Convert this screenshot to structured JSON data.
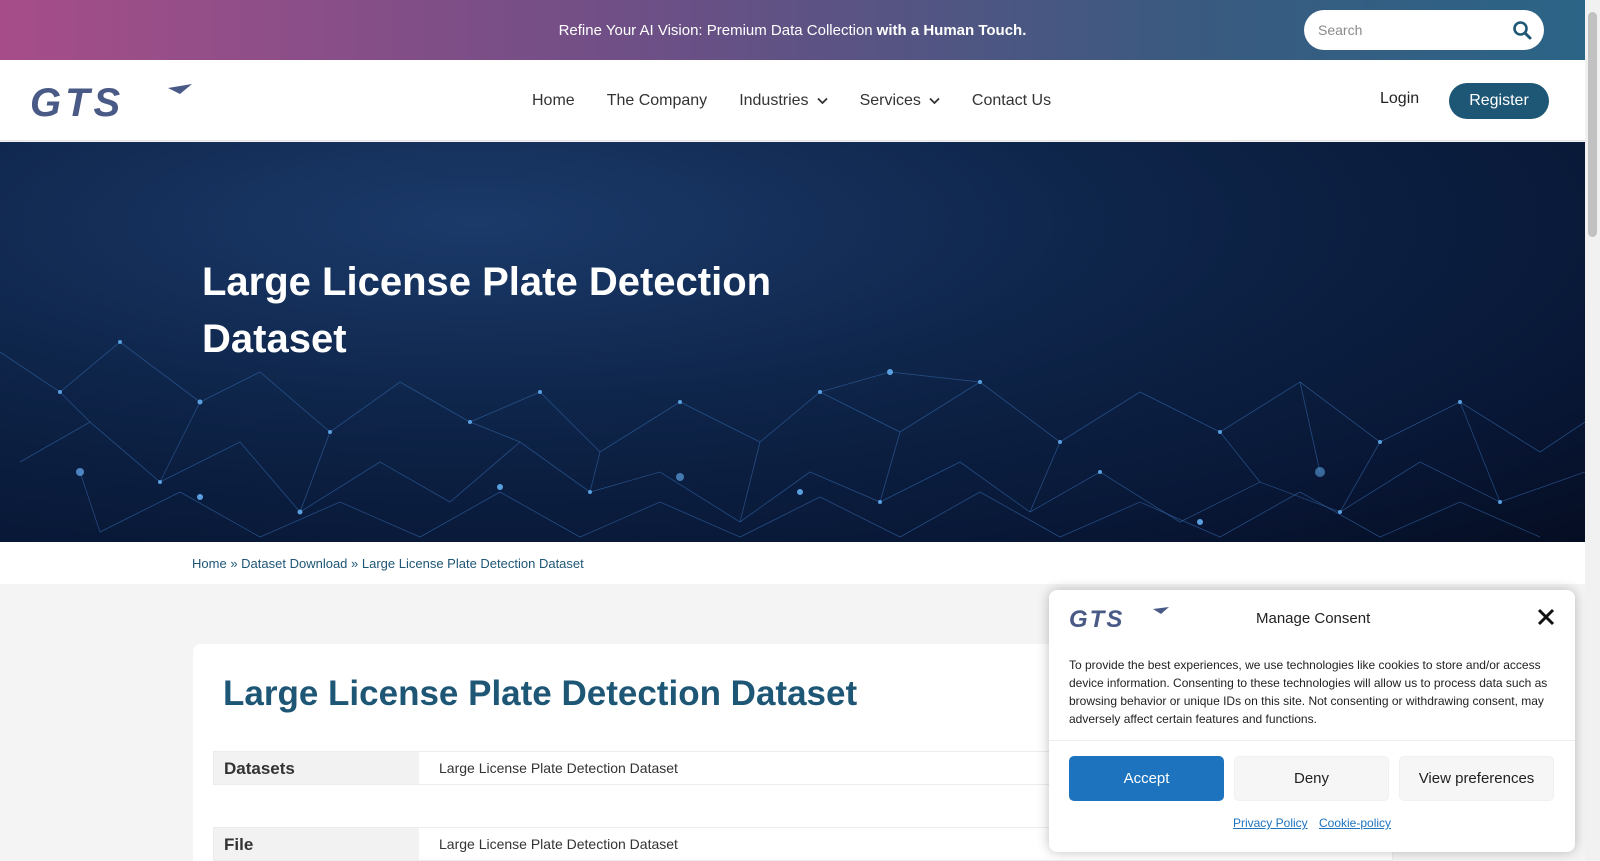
{
  "topbar": {
    "promo_text": "Refine Your AI Vision: Premium Data Collection",
    "promo_bold": "with a Human Touch.",
    "search_placeholder": "Search"
  },
  "header": {
    "logo_text": "GTS",
    "nav": [
      {
        "label": "Home"
      },
      {
        "label": "The Company"
      },
      {
        "label": "Industries",
        "has_dropdown": true
      },
      {
        "label": "Services",
        "has_dropdown": true
      },
      {
        "label": "Contact Us"
      }
    ],
    "login_label": "Login",
    "register_label": "Register"
  },
  "hero": {
    "title": "Large License Plate Detection Dataset"
  },
  "breadcrumb": {
    "items": [
      "Home",
      "Dataset Download",
      "Large License Plate Detection Dataset"
    ],
    "separator": "»"
  },
  "card": {
    "title": "Large License Plate Detection Dataset",
    "rows": [
      {
        "label": "Datasets",
        "value": "Large License Plate Detection Dataset"
      },
      {
        "label": "File",
        "value": "Large License Plate Detection Dataset"
      }
    ]
  },
  "consent": {
    "title": "Manage Consent",
    "text": "To provide the best experiences, we use technologies like cookies to store and/or access device information. Consenting to these technologies will allow us to process data such as browsing behavior or unique IDs on this site. Not consenting or withdrawing consent, may adversely affect certain features and functions.",
    "accept_label": "Accept",
    "deny_label": "Deny",
    "preferences_label": "View preferences",
    "privacy_link": "Privacy Policy",
    "cookie_link": "Cookie-policy"
  },
  "colors": {
    "brand_dark": "#1e5675",
    "accept_blue": "#1e73be",
    "logo_slate": "#4a5a86"
  }
}
